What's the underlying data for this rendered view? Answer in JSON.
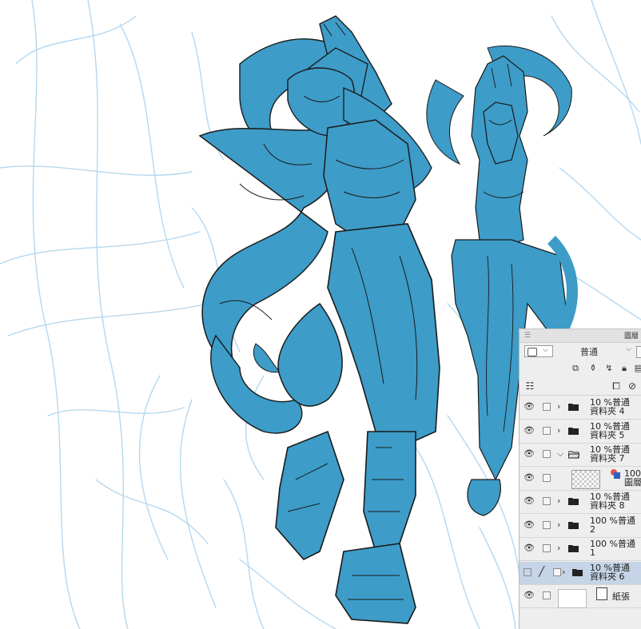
{
  "colors": {
    "line_blue": "#3d9cc8",
    "sketch_blue": "#b6d7ee",
    "ink": "#1a1a1a",
    "panel_bg": "#eeeeee",
    "selected_row": "#c5d4e6"
  },
  "panel": {
    "title": "圖層",
    "blend_mode": "普通",
    "icons": [
      "new-raster-layer-icon",
      "new-vector-layer-icon",
      "mask-icon",
      "lock-icon",
      "lock-alpha-icon",
      "layer-property-icon",
      "new-folder-icon",
      "delete-layer-icon"
    ]
  },
  "layers": [
    {
      "line1": "10 %普通",
      "line2": "資料夾 4",
      "type": "folder",
      "expanded": false,
      "visible": true,
      "selected": false
    },
    {
      "line1": "10 %普通",
      "line2": "資料夾 5",
      "type": "folder",
      "expanded": false,
      "visible": true,
      "selected": false
    },
    {
      "line1": "10 %普通",
      "line2": "資料夾 7",
      "type": "folder",
      "expanded": true,
      "visible": true,
      "selected": false
    },
    {
      "line1": "100",
      "line2": "圖層",
      "type": "raster",
      "visible": true,
      "selected": false
    },
    {
      "line1": "10 %普通",
      "line2": "資料夾 8",
      "type": "folder",
      "expanded": false,
      "visible": true,
      "selected": false
    },
    {
      "line1": "100 %普通",
      "line2": "2",
      "type": "folder",
      "expanded": false,
      "visible": true,
      "selected": false
    },
    {
      "line1": "100 %普通",
      "line2": "1",
      "type": "folder",
      "expanded": false,
      "visible": true,
      "selected": false
    },
    {
      "line1": "10 %普通",
      "line2": "資料夾 6",
      "type": "folder",
      "expanded": false,
      "visible": false,
      "selected": true
    },
    {
      "line1": "紙張",
      "line2": "",
      "type": "paper",
      "visible": true,
      "selected": false
    }
  ]
}
